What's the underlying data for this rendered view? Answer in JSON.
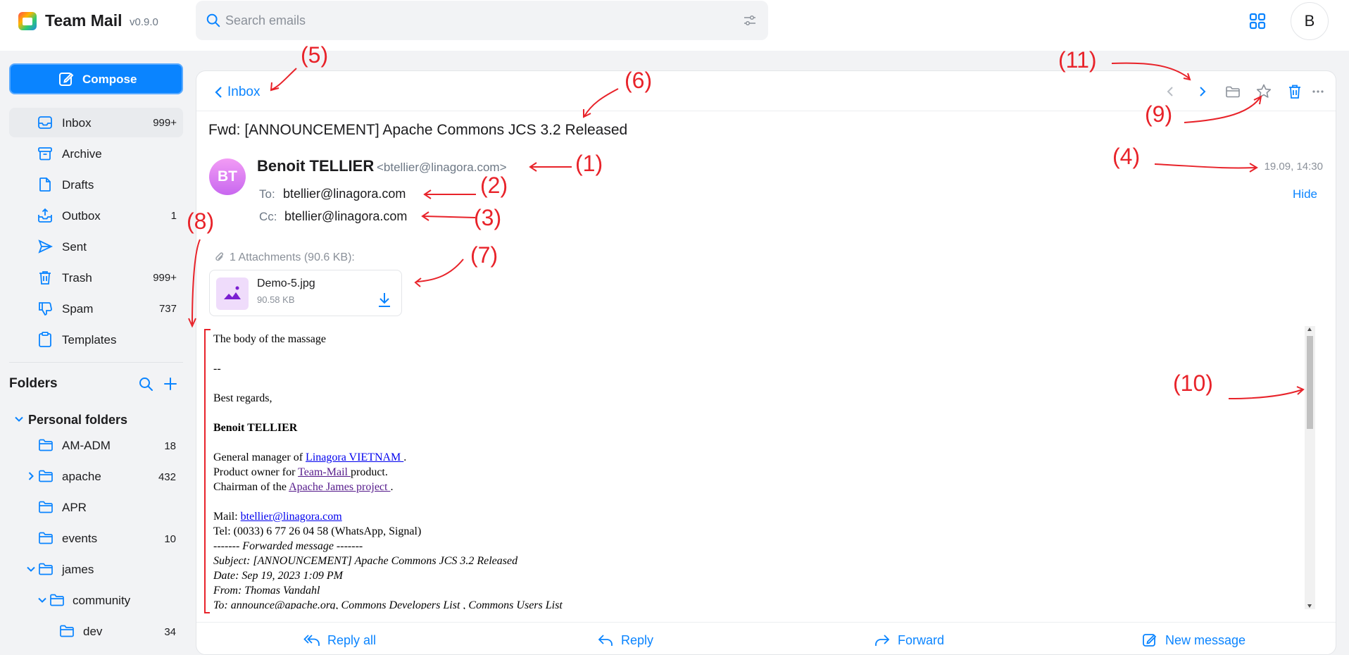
{
  "app": {
    "name": "Team Mail",
    "version": "v0.9.0"
  },
  "search": {
    "placeholder": "Search emails",
    "value": ""
  },
  "user": {
    "initial": "B"
  },
  "sidebar": {
    "compose_label": "Compose",
    "items": [
      {
        "label": "Inbox",
        "count": "999+",
        "icon": "inbox-icon"
      },
      {
        "label": "Archive",
        "count": "",
        "icon": "archive-icon"
      },
      {
        "label": "Drafts",
        "count": "",
        "icon": "drafts-icon"
      },
      {
        "label": "Outbox",
        "count": "1",
        "icon": "outbox-icon"
      },
      {
        "label": "Sent",
        "count": "",
        "icon": "sent-icon"
      },
      {
        "label": "Trash",
        "count": "999+",
        "icon": "trash-icon"
      },
      {
        "label": "Spam",
        "count": "737",
        "icon": "spam-icon"
      },
      {
        "label": "Templates",
        "count": "",
        "icon": "templates-icon"
      }
    ],
    "folders_title": "Folders",
    "personal_folders_label": "Personal folders",
    "folders": [
      {
        "label": "AM-ADM",
        "count": "18"
      },
      {
        "label": "apache",
        "count": "432"
      },
      {
        "label": "APR",
        "count": ""
      },
      {
        "label": "events",
        "count": "10"
      },
      {
        "label": "james",
        "count": ""
      },
      {
        "label": "community",
        "count": ""
      },
      {
        "label": "dev",
        "count": "34"
      }
    ]
  },
  "email": {
    "back_label": "Inbox",
    "subject": "Fwd: [ANNOUNCEMENT] Apache Commons JCS 3.2 Released",
    "sender_initials": "BT",
    "sender_name": "Benoit TELLIER",
    "sender_email": "<btellier@linagora.com>",
    "date": "19.09, 14:30",
    "to_label": "To:",
    "to_value": "btellier@linagora.com",
    "cc_label": "Cc:",
    "cc_value": "btellier@linagora.com",
    "hide_label": "Hide",
    "attachments_header": "1 Attachments (90.6 KB):",
    "attachment": {
      "name": "Demo-5.jpg",
      "size": "90.58 KB"
    },
    "body": {
      "line1": "The body of the massage",
      "line2": "--",
      "line3": "Best regards,",
      "sig_name": "Benoit TELLIER",
      "gm_prefix": "General manager of ",
      "gm_link": "Linagora VIETNAM ",
      "gm_suffix": ".",
      "po_prefix": "Product owner for ",
      "po_link": "Team-Mail ",
      "po_suffix": "product.",
      "ch_prefix": "Chairman of the ",
      "ch_link": "Apache James project ",
      "ch_suffix": ".",
      "mail_prefix": "Mail: ",
      "mail_link": "btellier@linagora.com",
      "tel": "Tel: (0033) 6 77 26 04 58 (WhatsApp, Signal)",
      "fwd_prefix": "------- ",
      "fwd_label": "Forwarded message",
      "fwd_suffix": " -------",
      "fwd_subject": "Subject: [ANNOUNCEMENT] Apache Commons JCS 3.2 Released",
      "fwd_date": "Date: Sep 19, 2023 1:09 PM",
      "fwd_from": "From: Thomas Vandahl",
      "fwd_to": "To: announce@apache.org, Commons Developers List , Commons Users List"
    },
    "actions": {
      "reply_all": "Reply all",
      "reply": "Reply",
      "forward": "Forward",
      "new_message": "New message"
    }
  },
  "annotations": [
    "(1)",
    "(2)",
    "(3)",
    "(4)",
    "(5)",
    "(6)",
    "(7)",
    "(8)",
    "(9)",
    "(10)",
    "(11)"
  ],
  "colors": {
    "accent": "#0a84ff",
    "annotation": "#e8232a",
    "avatar": "#d47cf2"
  }
}
